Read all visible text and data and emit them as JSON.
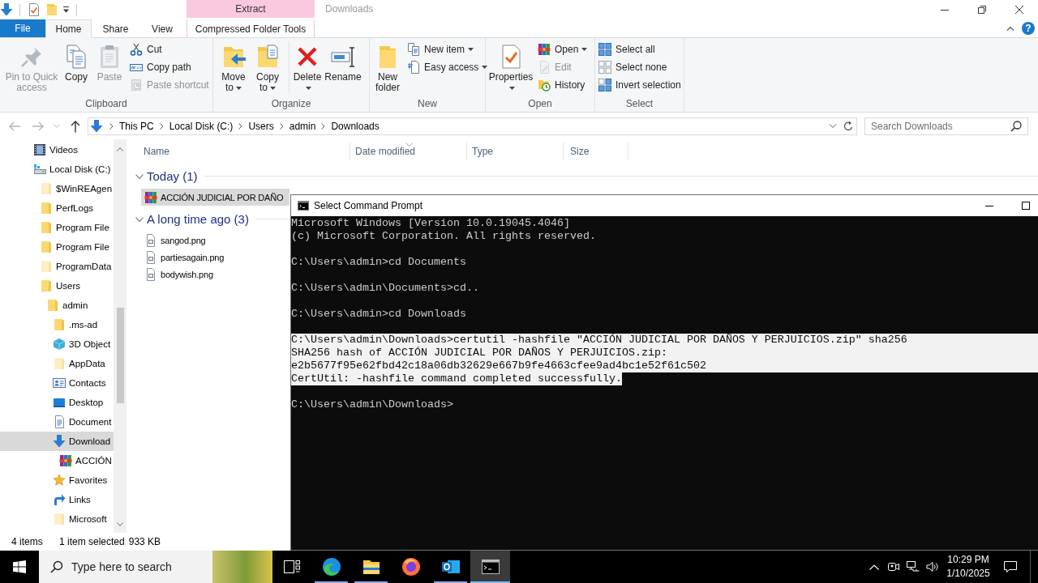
{
  "explorer": {
    "title": "Downloads",
    "contextual_tab_group": "Extract",
    "tabs": [
      {
        "label": "File",
        "kind": "backstage",
        "selected": false
      },
      {
        "label": "Home",
        "kind": "tab",
        "selected": true
      },
      {
        "label": "Share",
        "kind": "tab",
        "selected": false
      },
      {
        "label": "View",
        "kind": "tab",
        "selected": false
      },
      {
        "label": "Compressed Folder Tools",
        "kind": "contextual",
        "selected": false
      }
    ],
    "help": "?",
    "ribbon": [
      {
        "label": "Clipboard",
        "buttons": [
          {
            "label": "Pin to Quick access",
            "kind": "large",
            "disabled": true,
            "dropdown": false
          },
          {
            "label": "Copy",
            "kind": "large",
            "disabled": false,
            "dropdown": false
          },
          {
            "label": "Paste",
            "kind": "large",
            "disabled": true,
            "dropdown": false
          },
          {
            "label": "Cut",
            "kind": "small",
            "disabled": false,
            "dropdown": false
          },
          {
            "label": "Copy path",
            "kind": "small",
            "disabled": false,
            "dropdown": false
          },
          {
            "label": "Paste shortcut",
            "kind": "small",
            "disabled": true,
            "dropdown": false
          }
        ]
      },
      {
        "label": "Organize",
        "buttons": [
          {
            "label": "Move to",
            "kind": "large",
            "disabled": false,
            "dropdown": true
          },
          {
            "label": "Copy to",
            "kind": "large",
            "disabled": false,
            "dropdown": true
          },
          {
            "label": "Delete",
            "kind": "large",
            "disabled": false,
            "dropdown": true
          },
          {
            "label": "Rename",
            "kind": "large",
            "disabled": false,
            "dropdown": false
          }
        ]
      },
      {
        "label": "New",
        "buttons": [
          {
            "label": "New folder",
            "kind": "large",
            "disabled": false,
            "dropdown": false
          },
          {
            "label": "New item",
            "kind": "small",
            "disabled": false,
            "dropdown": true
          },
          {
            "label": "Easy access",
            "kind": "small",
            "disabled": false,
            "dropdown": true
          }
        ]
      },
      {
        "label": "Open",
        "buttons": [
          {
            "label": "Properties",
            "kind": "large",
            "disabled": false,
            "dropdown": true
          },
          {
            "label": "Open",
            "kind": "small",
            "disabled": false,
            "dropdown": true
          },
          {
            "label": "Edit",
            "kind": "small",
            "disabled": true,
            "dropdown": false
          },
          {
            "label": "History",
            "kind": "small",
            "disabled": false,
            "dropdown": false
          }
        ]
      },
      {
        "label": "Select",
        "buttons": [
          {
            "label": "Select all",
            "kind": "small",
            "disabled": false,
            "dropdown": false
          },
          {
            "label": "Select none",
            "kind": "small",
            "disabled": false,
            "dropdown": false
          },
          {
            "label": "Invert selection",
            "kind": "small",
            "disabled": false,
            "dropdown": false
          }
        ]
      }
    ],
    "address_bar": {
      "crumbs": [
        "This PC",
        "Local Disk (C:)",
        "Users",
        "admin",
        "Downloads"
      ]
    },
    "search": {
      "placeholder": "Search Downloads"
    },
    "sidebar": {
      "items": [
        {
          "label": "Videos",
          "selected": false
        },
        {
          "label": "Local Disk (C:)",
          "selected": false,
          "children": [
            {
              "label": "$WinREAgen",
              "selected": false
            },
            {
              "label": "PerfLogs",
              "selected": false
            },
            {
              "label": "Program File",
              "selected": false
            },
            {
              "label": "Program File",
              "selected": false
            },
            {
              "label": "ProgramData",
              "selected": false
            },
            {
              "label": "Users",
              "selected": false,
              "children": [
                {
                  "label": "admin",
                  "selected": false,
                  "children": [
                    {
                      "label": ".ms-ad",
                      "selected": false
                    },
                    {
                      "label": "3D Object",
                      "selected": false
                    },
                    {
                      "label": "AppData",
                      "selected": false
                    },
                    {
                      "label": "Contacts",
                      "selected": false
                    },
                    {
                      "label": "Desktop",
                      "selected": false
                    },
                    {
                      "label": "Document",
                      "selected": false
                    },
                    {
                      "label": "Download",
                      "selected": true,
                      "children": [
                        {
                          "label": "ACCIÓN",
                          "selected": false
                        }
                      ]
                    },
                    {
                      "label": "Favorites",
                      "selected": false
                    },
                    {
                      "label": "Links",
                      "selected": false
                    },
                    {
                      "label": "Microsoft",
                      "selected": false
                    }
                  ]
                }
              ]
            }
          ]
        }
      ]
    },
    "columns": [
      {
        "label": "Name",
        "sorted": false
      },
      {
        "label": "Date modified",
        "sorted": true
      },
      {
        "label": "Type",
        "sorted": false
      },
      {
        "label": "Size",
        "sorted": false
      }
    ],
    "groups": [
      {
        "label": "Today (1)",
        "expanded": true,
        "files": [
          {
            "name": "ACCIÓN JUDICIAL POR DAÑO",
            "selected": true
          }
        ]
      },
      {
        "label": "A long time ago (3)",
        "expanded": true,
        "files": [
          {
            "name": "sangod.png",
            "selected": false
          },
          {
            "name": "partiesagain.png",
            "selected": false
          },
          {
            "name": "bodywish.png",
            "selected": false
          }
        ]
      }
    ],
    "status_bar": {
      "items": "4 items",
      "selection": "1 item selected",
      "size": "933 KB"
    }
  },
  "command_prompt": {
    "title": "Select Command Prompt",
    "blocks": [
      {
        "lines": [
          {
            "text": "Microsoft Windows [Version 10.0.19045.4046]",
            "selected": false
          },
          {
            "text": "(c) Microsoft Corporation. All rights reserved.",
            "selected": false
          }
        ]
      },
      {
        "lines": [
          {
            "text": "C:\\Users\\admin>cd Documents",
            "selected": false
          }
        ]
      },
      {
        "lines": [
          {
            "text": "C:\\Users\\admin\\Documents>cd..",
            "selected": false
          }
        ]
      },
      {
        "lines": [
          {
            "text": "C:\\Users\\admin>cd Downloads",
            "selected": false
          }
        ]
      },
      {
        "lines": [
          {
            "text": "C:\\Users\\admin\\Downloads>certutil -hashfile \"ACCIÓN JUDICIAL POR DAÑOS Y PERJUICIOS.zip\" sha256",
            "selected": true
          },
          {
            "text": "SHA256 hash of ACCIÓN JUDICIAL POR DAÑOS Y PERJUICIOS.zip:",
            "selected": true
          },
          {
            "text": "e2b5677f95e62fbd42c18a06db32629e667b9fe4663cfee9ad4bc1e52f61c502",
            "selected": true
          },
          {
            "text": "CertUtil: -hashfile command completed successfully.",
            "selected": true
          }
        ]
      },
      {
        "lines": [
          {
            "text": "C:\\Users\\admin\\Downloads>",
            "selected": false
          }
        ]
      }
    ]
  },
  "taskbar": {
    "search": {
      "placeholder": "Type here to search"
    },
    "apps": [
      {
        "active": false,
        "running": true
      },
      {
        "active": false,
        "running": true
      },
      {
        "active": false,
        "running": false
      },
      {
        "active": false,
        "running": true
      },
      {
        "active": true,
        "running": true
      }
    ],
    "time": "10:29 PM",
    "date": "1/10/2025"
  }
}
